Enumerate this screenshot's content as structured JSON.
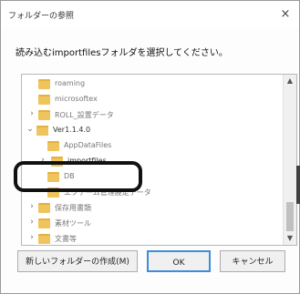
{
  "dialog": {
    "title": "フォルダーの参照",
    "close_label": "×",
    "prompt": "読み込むimportfilesフォルダを選択してください。"
  },
  "tree": {
    "items": [
      {
        "label": "roaming",
        "expander": ""
      },
      {
        "label": "microsoftex",
        "expander": ""
      },
      {
        "label": "ROLL_設置データ",
        "expander": "›"
      },
      {
        "label": "Ver1.1.4.0",
        "expander": "⌄"
      },
      {
        "label": "AppDataFiles",
        "expander": ""
      },
      {
        "label": "importfiles",
        "expander": "›"
      },
      {
        "label": "DB",
        "expander": ""
      },
      {
        "label": "エクテーム管理設定データ",
        "expander": ""
      },
      {
        "label": "保存用書類",
        "expander": "›"
      },
      {
        "label": "素材ツール",
        "expander": "›"
      },
      {
        "label": "文書等",
        "expander": "›"
      }
    ],
    "scroll_up": "▲",
    "scroll_down": "▼"
  },
  "buttons": {
    "new_folder": "新しいフォルダーの作成(M)",
    "ok": "OK",
    "cancel": "キャンセル"
  }
}
